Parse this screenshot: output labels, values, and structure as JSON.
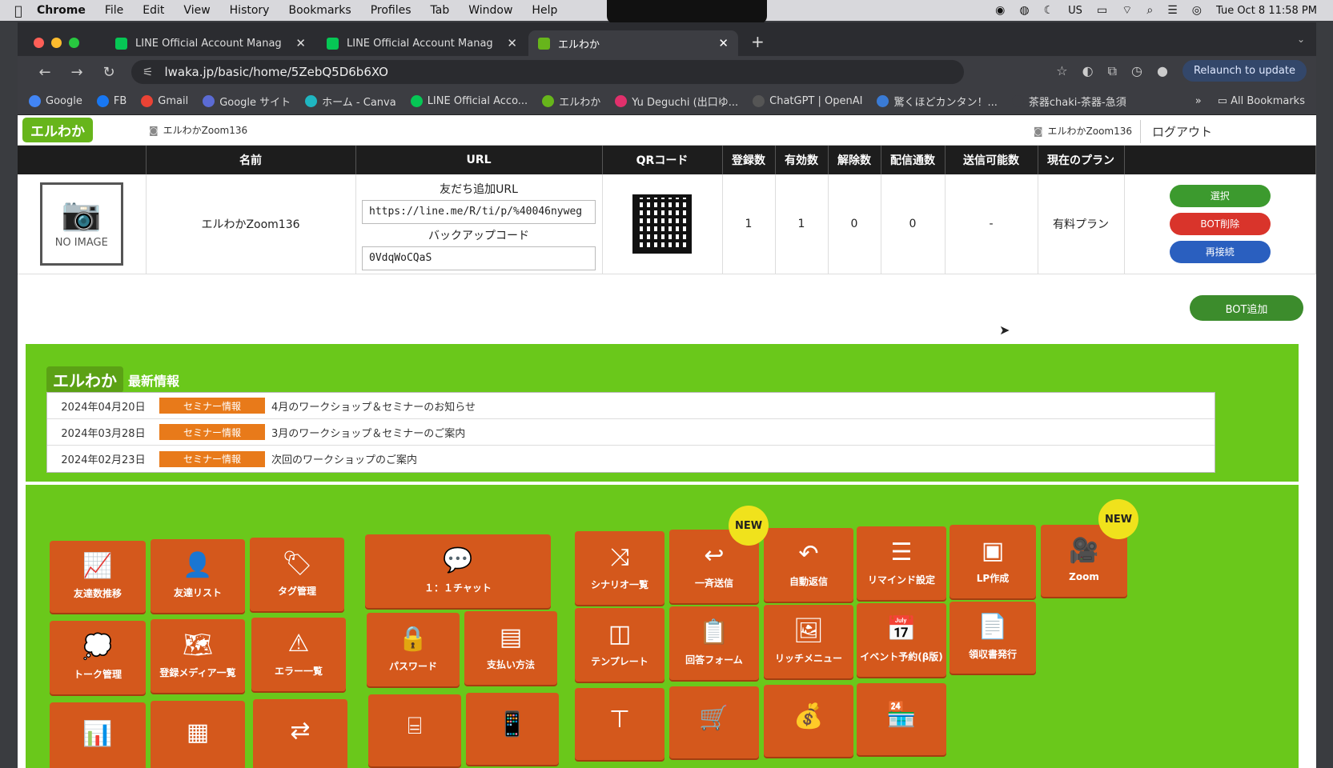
{
  "menubar": {
    "items": [
      "Chrome",
      "File",
      "Edit",
      "View",
      "History",
      "Bookmarks",
      "Profiles",
      "Tab",
      "Window",
      "Help"
    ],
    "input_source": "US",
    "datetime": "Tue Oct 8  11:58 PM"
  },
  "tabs": [
    {
      "label": "LINE Official Account Manag",
      "active": false
    },
    {
      "label": "LINE Official Account Manag",
      "active": false
    },
    {
      "label": "エルわか",
      "active": true
    }
  ],
  "address": {
    "url": "lwaka.jp/basic/home/5ZebQ5D6b6XO",
    "relaunch_label": "Relaunch to update"
  },
  "bookmarks": {
    "items": [
      {
        "label": "Google",
        "color": "#4285f4"
      },
      {
        "label": "FB",
        "color": "#1877f2"
      },
      {
        "label": "Gmail",
        "color": "#ea4335"
      },
      {
        "label": "Google サイト",
        "color": "#5b6bd4"
      },
      {
        "label": "ホーム - Canva",
        "color": "#1fb6c1"
      },
      {
        "label": "LINE Official Acco...",
        "color": "#06c755"
      },
      {
        "label": "エルわか",
        "color": "#67b51b"
      },
      {
        "label": "Yu Deguchi (出口ゆ...",
        "color": "#e1306c"
      },
      {
        "label": "ChatGPT | OpenAI",
        "color": "#555555"
      },
      {
        "label": "驚くほどカンタン！...",
        "color": "#3a7bd5"
      },
      {
        "label": "茶器chaki-茶器-急須",
        "color": "#3c3d42"
      }
    ],
    "all_label": "All Bookmarks"
  },
  "header": {
    "logo": "エルわか",
    "account_left": "エルわかZoom136",
    "account_right": "エルわかZoom136",
    "logout": "ログアウト"
  },
  "table": {
    "headers": [
      "",
      "名前",
      "URL",
      "QRコード",
      "登録数",
      "有効数",
      "解除数",
      "配信通数",
      "送信可能数",
      "現在のプラン",
      ""
    ],
    "row": {
      "no_image": "NO IMAGE",
      "name": "エルわかZoom136",
      "url_label": "友だち追加URL",
      "url_value": "https://line.me/R/ti/p/%40046nyweg",
      "backup_label": "バックアップコード",
      "backup_value": "0VdqWoCQaS",
      "registered": "1",
      "valid": "1",
      "unsubscribed": "0",
      "delivered": "0",
      "sendable": "-",
      "plan": "有料プラン"
    },
    "actions": {
      "select": "選択",
      "delete": "BOT削除",
      "reconnect": "再接続"
    }
  },
  "add_bot": "BOT追加",
  "news": {
    "logo": "エルわか",
    "title": "最新情報",
    "items": [
      {
        "date": "2024年04月20日",
        "badge": "セミナー情報",
        "title": "4月のワークショップ＆セミナーのお知らせ"
      },
      {
        "date": "2024年03月28日",
        "badge": "セミナー情報",
        "title": "3月のワークショップ＆セミナーのご案内"
      },
      {
        "date": "2024年02月23日",
        "badge": "セミナー情報",
        "title": "次回のワークショップのご案内"
      }
    ]
  },
  "menu": {
    "new_label": "NEW",
    "tiles": [
      {
        "key": "friend-count-trend",
        "label": "友達数推移",
        "icon": "chart-line-icon"
      },
      {
        "key": "friend-list",
        "label": "友達リスト",
        "icon": "person-icon"
      },
      {
        "key": "tag-management",
        "label": "タグ管理",
        "icon": "tag-icon"
      },
      {
        "key": "chat",
        "label": "１：１チャット",
        "icon": "chat-bubble-icon"
      },
      {
        "key": "scenario-list",
        "label": "シナリオ一覧",
        "icon": "shuffle-icon"
      },
      {
        "key": "broadcast",
        "label": "一斉送信",
        "icon": "reply-arrow-icon"
      },
      {
        "key": "auto-reply",
        "label": "自動返信",
        "icon": "return-arrow-icon"
      },
      {
        "key": "remind",
        "label": "リマインド設定",
        "icon": "list-icon"
      },
      {
        "key": "lp",
        "label": "LP作成",
        "icon": "webpage-icon"
      },
      {
        "key": "zoom",
        "label": "Zoom",
        "icon": "video-camera-icon"
      },
      {
        "key": "talk",
        "label": "トーク管理",
        "icon": "speech-bubble-icon"
      },
      {
        "key": "media",
        "label": "登録メディア一覧",
        "icon": "map-icon"
      },
      {
        "key": "errors",
        "label": "エラー一覧",
        "icon": "warning-icon"
      },
      {
        "key": "password",
        "label": "パスワード",
        "icon": "lock-icon"
      },
      {
        "key": "payment",
        "label": "支払い方法",
        "icon": "card-icon"
      },
      {
        "key": "template",
        "label": "テンプレート",
        "icon": "columns-icon"
      },
      {
        "key": "form",
        "label": "回答フォーム",
        "icon": "clipboard-icon"
      },
      {
        "key": "rich-menu",
        "label": "リッチメニュー",
        "icon": "image-icon"
      },
      {
        "key": "event",
        "label": "イベント予約(β版)",
        "icon": "calendar-icon"
      },
      {
        "key": "receipt",
        "label": "領収書発行",
        "icon": "document-icon"
      },
      {
        "key": "analytics",
        "label": "",
        "icon": "analytics-icon"
      },
      {
        "key": "window",
        "label": "",
        "icon": "browser-window-icon"
      },
      {
        "key": "transfer",
        "label": "",
        "icon": "swap-arrows-icon"
      },
      {
        "key": "storage",
        "label": "",
        "icon": "drive-icon"
      },
      {
        "key": "mobile",
        "label": "",
        "icon": "phone-icon"
      },
      {
        "key": "hierarchy",
        "label": "",
        "icon": "org-chart-icon"
      },
      {
        "key": "cart",
        "label": "",
        "icon": "cart-icon"
      },
      {
        "key": "money",
        "label": "",
        "icon": "money-bag-icon"
      },
      {
        "key": "store",
        "label": "",
        "icon": "store-icon"
      }
    ]
  },
  "colors": {
    "green_band": "#6ac81b",
    "tile_orange": "#d4581c",
    "select_green": "#3c9a2e",
    "delete_red": "#d9342b",
    "reconnect_blue": "#2a5fbf"
  }
}
